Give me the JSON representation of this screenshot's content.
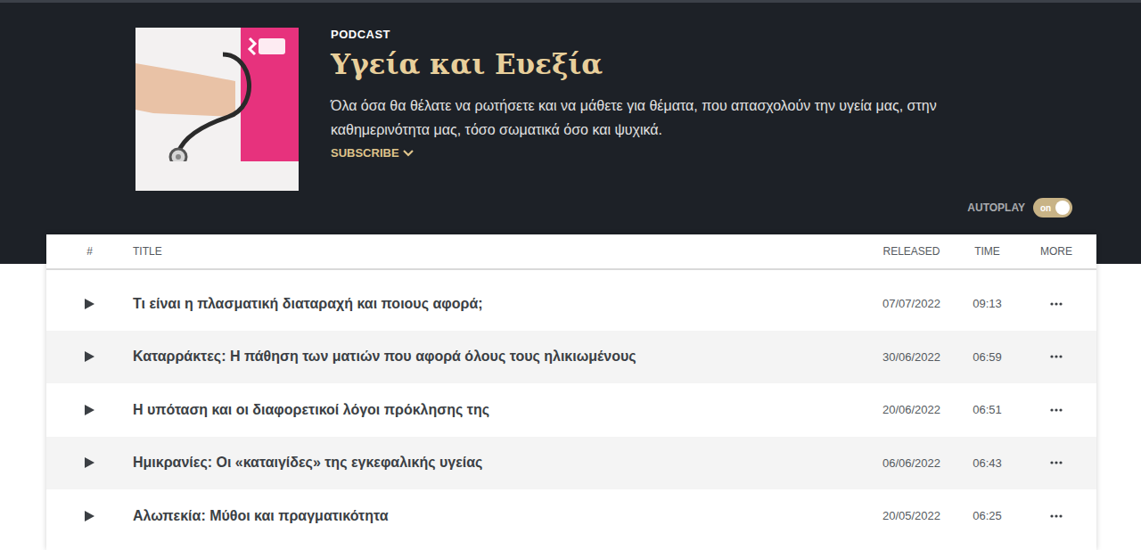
{
  "page": {
    "type_label": "PODCAST",
    "title": "Υγεία και Ευεξία",
    "description": "Όλα όσα θα θέλατε να ρωτήσετε και να μάθετε για θέματα, που απασχολούν την υγεία μας, στην καθημερινότητα μας, τόσο σωματικά όσο και ψυχικά.",
    "subscribe": "SUBSCRIBE"
  },
  "autoplay": {
    "label": "AUTOPLAY",
    "on": true,
    "state_text": "on"
  },
  "table": {
    "columns": [
      "#",
      "TITLE",
      "RELEASED",
      "TIME",
      "MORE"
    ],
    "rows": [
      {
        "title": "Τι είναι η πλασματική διαταραχή και ποιους αφορά;",
        "released": "07/07/2022",
        "time": "09:13"
      },
      {
        "title": "Καταρράκτες: Η πάθηση των ματιών που αφορά όλους τους ηλικιωμένους",
        "released": "30/06/2022",
        "time": "06:59"
      },
      {
        "title": "Η υπόταση και οι διαφορετικοί λόγοι πρόκλησης της",
        "released": "20/06/2022",
        "time": "06:51"
      },
      {
        "title": "Ημικρανίες: Οι «καταιγίδες» της εγκεφαλικής υγείας",
        "released": "06/06/2022",
        "time": "06:43"
      },
      {
        "title": "Αλωπεκία: Μύθοι και πραγματικότητα",
        "released": "20/05/2022",
        "time": "06:25"
      }
    ]
  }
}
